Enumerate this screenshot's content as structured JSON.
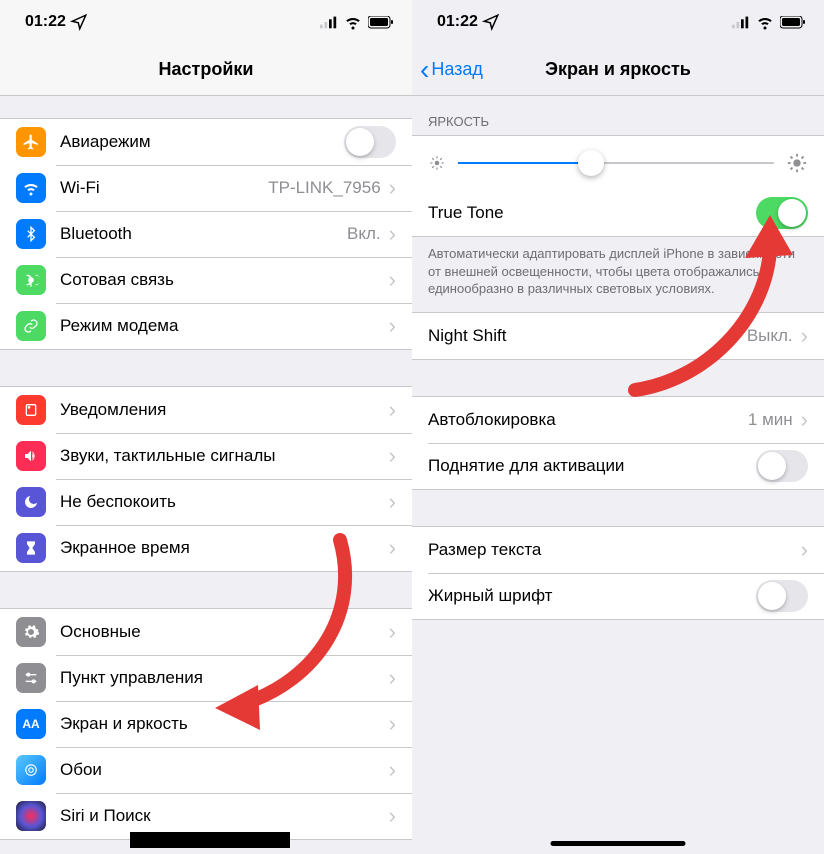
{
  "status": {
    "time": "01:22",
    "location_icon": "location"
  },
  "left": {
    "title": "Настройки",
    "groups": [
      [
        {
          "icon": "airplane",
          "color": "#ff9500",
          "label": "Авиарежим",
          "type": "toggle",
          "on": false
        },
        {
          "icon": "wifi",
          "color": "#007aff",
          "label": "Wi-Fi",
          "value": "TP-LINK_7956",
          "type": "link"
        },
        {
          "icon": "bluetooth",
          "color": "#007aff",
          "label": "Bluetooth",
          "value": "Вкл.",
          "type": "link"
        },
        {
          "icon": "antenna",
          "color": "#4cd964",
          "label": "Сотовая связь",
          "type": "link"
        },
        {
          "icon": "link",
          "color": "#4cd964",
          "label": "Режим модема",
          "type": "link"
        }
      ],
      [
        {
          "icon": "bell",
          "color": "#ff3b30",
          "label": "Уведомления",
          "type": "link"
        },
        {
          "icon": "speaker",
          "color": "#ff2d55",
          "label": "Звуки, тактильные сигналы",
          "type": "link"
        },
        {
          "icon": "moon",
          "color": "#5856d6",
          "label": "Не беспокоить",
          "type": "link"
        },
        {
          "icon": "hourglass",
          "color": "#5856d6",
          "label": "Экранное время",
          "type": "link"
        }
      ],
      [
        {
          "icon": "gear",
          "color": "#8e8e93",
          "label": "Основные",
          "type": "link"
        },
        {
          "icon": "sliders",
          "color": "#8e8e93",
          "label": "Пункт управления",
          "type": "link"
        },
        {
          "icon": "textsize",
          "color": "#007aff",
          "label": "Экран и яркость",
          "type": "link"
        },
        {
          "icon": "wallpaper",
          "color": "#34aadc",
          "label": "Обои",
          "type": "link"
        },
        {
          "icon": "siri",
          "color": "#1a1a2e",
          "label": "Siri и Поиск",
          "type": "link"
        }
      ]
    ]
  },
  "right": {
    "back": "Назад",
    "title": "Экран и яркость",
    "brightness_header": "ЯРКОСТЬ",
    "truetone": {
      "label": "True Tone",
      "on": true
    },
    "truetone_desc": "Автоматически адаптировать дисплей iPhone в зависимости от внешней освещенности, чтобы цвета отображались единообразно в различных световых условиях.",
    "nightshift": {
      "label": "Night Shift",
      "value": "Выкл."
    },
    "autolock": {
      "label": "Автоблокировка",
      "value": "1 мин"
    },
    "raise": {
      "label": "Поднятие для активации",
      "on": false
    },
    "textsize": {
      "label": "Размер текста"
    },
    "bold": {
      "label": "Жирный шрифт",
      "on": false
    }
  }
}
